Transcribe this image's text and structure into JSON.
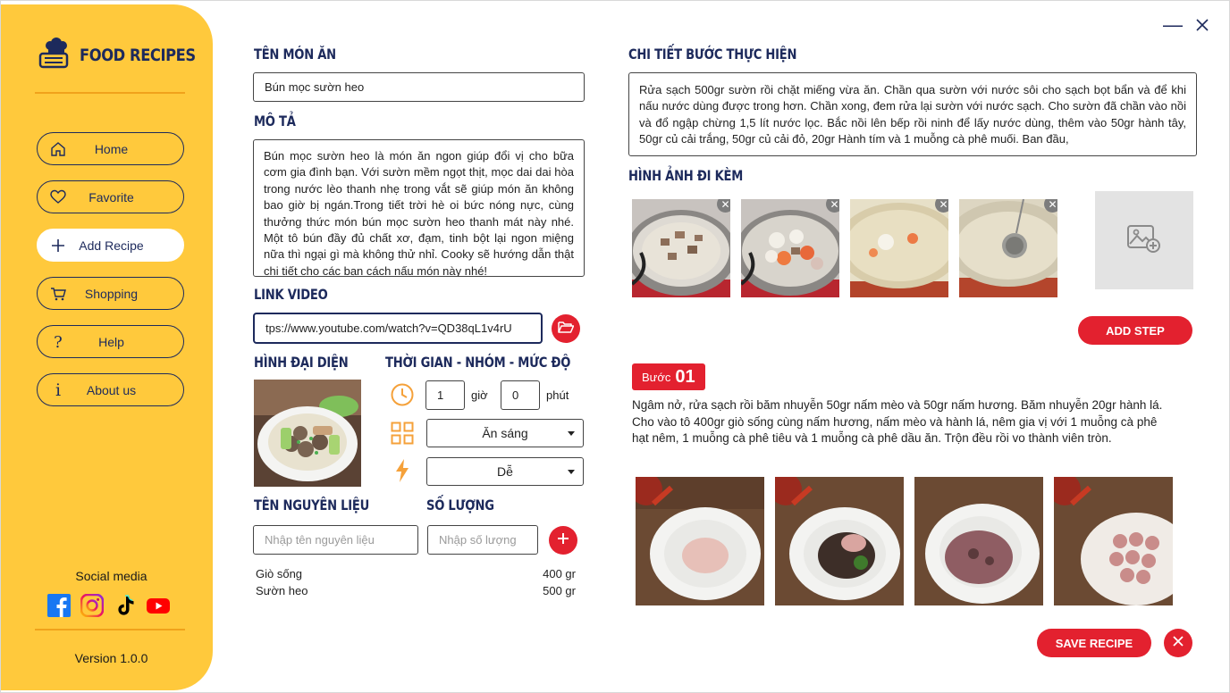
{
  "app": {
    "title": "FOOD RECIPES",
    "version": "Version 1.0.0",
    "social_title": "Social media"
  },
  "sidebar": {
    "items": [
      {
        "label": "Home",
        "icon": "home-icon"
      },
      {
        "label": "Favorite",
        "icon": "heart-icon"
      },
      {
        "label": "Add Recipe",
        "icon": "plus-icon",
        "active": true
      },
      {
        "label": "Shopping",
        "icon": "cart-icon"
      },
      {
        "label": "Help",
        "icon": "question-icon"
      },
      {
        "label": "About us",
        "icon": "info-icon"
      }
    ],
    "social": [
      "facebook-icon",
      "instagram-icon",
      "tiktok-icon",
      "youtube-icon"
    ]
  },
  "form": {
    "name_heading": "TÊN MÓN ĂN",
    "name_value": "Bún mọc sườn heo",
    "desc_heading": "MÔ TẢ",
    "desc_value": "Bún mọc sườn heo là món ăn ngon giúp đổi vị cho bữa cơm gia đình bạn. Với sườn mềm ngọt thịt, mọc dai dai hòa trong nước lèo thanh nhẹ trong vắt sẽ giúp món ăn không bao giờ bị ngán.Trong tiết trời hè oi bức nóng nực, cùng thưởng thức món bún mọc sườn heo thanh mát này nhé. Một tô bún đầy đủ chất xơ, đạm, tinh bột lại ngon miệng nữa thì ngại gì mà không thử nhỉ. Cooky sẽ hướng dẫn thật chi tiết cho các bạn cách nấu món này nhé!",
    "video_heading": "LINK VIDEO",
    "video_value": "tps://www.youtube.com/watch?v=QD38qL1v4rU",
    "avatar_heading": "HÌNH ĐẠI DIỆN",
    "meta_heading": "THỜI GIAN - NHÓM - MỨC ĐỘ",
    "hours": "1",
    "hours_unit": "giờ",
    "minutes": "0",
    "minutes_unit": "phút",
    "group": "Ăn sáng",
    "level": "Dễ",
    "ing_name_heading": "TÊN NGUYÊN LIỆU",
    "ing_qty_heading": "SỐ LƯỢNG",
    "ing_name_placeholder": "Nhập tên nguyên liệu",
    "ing_qty_placeholder": "Nhập số lượng",
    "ingredients": [
      {
        "name": "Giò sống",
        "qty": "400 gr"
      },
      {
        "name": "Sườn heo",
        "qty": "500 gr"
      }
    ]
  },
  "steps": {
    "detail_heading": "CHI TIẾT BƯỚC THỰC HIỆN",
    "detail_value": "Rửa sạch 500gr sườn rồi chặt miếng vừa ăn. Chần qua sườn với nước sôi cho sạch bọt bẩn và để khi nấu nước dùng được trong hơn. Chần xong, đem rửa lại sườn với nước sạch. Cho sườn đã chần vào nồi và đổ ngập chừng 1,5 lít nước lọc. Bắc nồi lên bếp rồi ninh để lấy nước dùng, thêm vào 50gr hành tây, 50gr củ cải trắng, 50gr củ cải đỏ, 20gr Hành tím và 1 muỗng cà phê muối. Ban đầu,",
    "images_heading": "HÌNH ẢNH ĐI KÈM",
    "add_step_label": "ADD STEP",
    "step_label": "Bước",
    "step_number": "01",
    "step_text": "Ngâm nở, rửa sạch rồi băm nhuyễn 50gr nấm mèo và 50gr nấm hương. Băm nhuyễn 20gr hành lá. Cho vào tô 400gr giò sống cùng nấm hương, nấm mèo và hành lá, nêm gia vị với 1 muỗng cà phê hạt nêm, 1 muỗng cà phê tiêu và 1 muỗng cà phê dầu ăn. Trộn đều rồi vo thành viên tròn."
  },
  "actions": {
    "save_label": "SAVE RECIPE"
  },
  "colors": {
    "sidebar": "#ffc93c",
    "navy": "#1d2a5c",
    "accent_red": "#e3212f",
    "orange_icon": "#f5a13a"
  }
}
